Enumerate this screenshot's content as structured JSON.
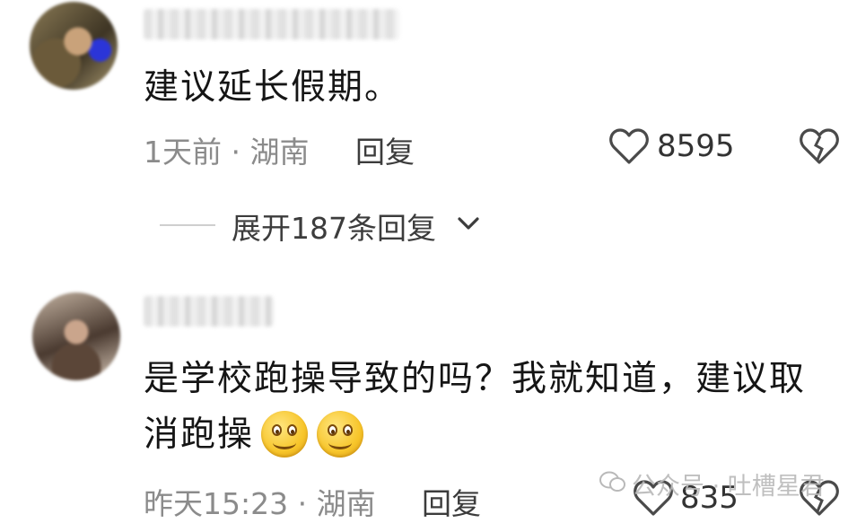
{
  "comments": [
    {
      "text": "建议延长假期。",
      "meta": "1天前 · 湖南",
      "reply_label": "回复",
      "likes": "8595",
      "expand_label": "展开187条回复"
    },
    {
      "text_line1": "是学校跑操导致的吗？我就知道，建议取",
      "text_line2": "消跑操",
      "meta": "昨天15:23 · 湖南",
      "reply_label": "回复",
      "likes": "835"
    }
  ],
  "watermark": "公众号 · 吐槽星君",
  "icons": {
    "like": "heart-outline-icon",
    "dislike": "broken-heart-icon",
    "expand": "chevron-down-icon",
    "emoji": "smiling-face-emoji-icon",
    "watermark": "wechat-icon"
  }
}
